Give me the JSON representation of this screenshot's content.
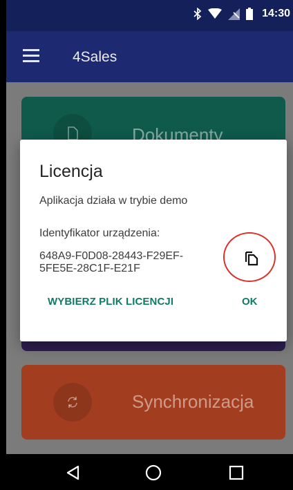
{
  "status_bar": {
    "time": "14:30",
    "icons": [
      "bluetooth-icon",
      "wifi-icon",
      "no-signal-icon",
      "battery-icon"
    ]
  },
  "app_bar": {
    "title": "4Sales",
    "menu_icon": "hamburger-menu-icon"
  },
  "tiles": {
    "documents": {
      "label": "Dokumenty",
      "icon": "document-icon",
      "color": "#0f5a4b"
    },
    "hidden_tile": {
      "color": "#2e1e50"
    },
    "sync": {
      "label": "Synchronizacja",
      "icon": "sync-icon",
      "color": "#a23e1f"
    }
  },
  "dialog": {
    "title": "Licencja",
    "message": "Aplikacja działa w trybie demo",
    "device_id_label": "Identyfikator urządzenia:",
    "device_id": "648A9-F0D08-28443-F29EF-5FE5E-28C1F-E21F",
    "copy_icon": "copy-icon",
    "buttons": {
      "choose_license": "WYBIERZ PLIK LICENCJI",
      "ok": "OK"
    },
    "accent_color": "#0f7a66",
    "highlight_color": "#d8322a"
  },
  "nav_bar": {
    "buttons": [
      "back-icon",
      "home-icon",
      "recents-icon"
    ]
  },
  "colors": {
    "status_bar": "#14205a",
    "app_bar": "#1d2a72"
  }
}
